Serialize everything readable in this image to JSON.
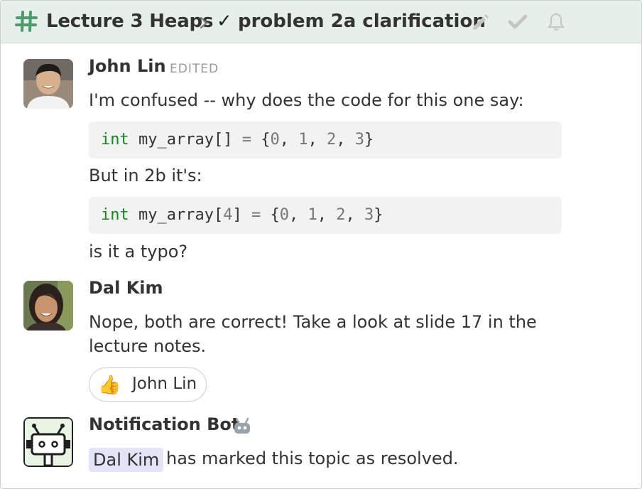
{
  "header": {
    "stream_name": "Lecture 3 Heaps",
    "resolved_mark": "✓",
    "topic_name": "problem 2a clarification",
    "accent_color": "#4a9c6b",
    "icons": [
      "hash-icon",
      "chevron-right-icon",
      "pencil-icon",
      "check-icon",
      "bell-icon"
    ]
  },
  "messages": [
    {
      "sender": "John Lin",
      "edited_label": "EDITED",
      "line1": "I'm confused -- why does the code for this one say:",
      "code1": {
        "kw": "int",
        "ident": "my_array[]",
        "eq": "=",
        "open": "{",
        "n0": "0",
        "n1": "1",
        "n2": "2",
        "n3": "3",
        "close": "}"
      },
      "line2": "But in 2b it's:",
      "code2": {
        "kw": "int",
        "ident": "my_array[",
        "size": "4",
        "ident_close": "]",
        "eq": "=",
        "open": "{",
        "n0": "0",
        "n1": "1",
        "n2": "2",
        "n3": "3",
        "close": "}"
      },
      "line3": "is it a typo?"
    },
    {
      "sender": "Dal Kim",
      "line1": "Nope, both are correct! Take a look at slide 17 in the",
      "line2": "lecture notes.",
      "reaction": {
        "emoji": "👍",
        "user": "John Lin"
      }
    },
    {
      "sender": "Notification Bot",
      "mention": "Dal Kim",
      "text": "has marked this topic as resolved."
    }
  ]
}
